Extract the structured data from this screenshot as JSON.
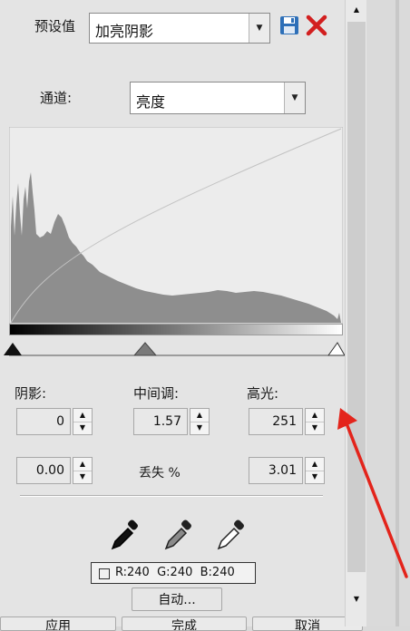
{
  "preset": {
    "label": "预设值",
    "value": "加亮阴影"
  },
  "channel": {
    "label": "通道:",
    "value": "亮度"
  },
  "levels": {
    "shadow": {
      "label": "阴影:",
      "value": "0",
      "clip": "0.00"
    },
    "midtone": {
      "label": "中间调:",
      "value": "1.57"
    },
    "highlight": {
      "label": "高光:",
      "value": "251",
      "clip": "3.01"
    },
    "clip_label": "丢失 %"
  },
  "color_readout": "R:240  G:240  B:240",
  "buttons": {
    "auto": "自动...",
    "apply": "应用",
    "ok": "完成",
    "cancel": "取消"
  },
  "icons": {
    "save": "save-icon",
    "delete": "close-icon",
    "black_eyedropper": "eyedropper-black-icon",
    "gray_eyedropper": "eyedropper-gray-icon",
    "white_eyedropper": "eyedropper-white-icon"
  },
  "colors": {
    "delete_red": "#d21f1f",
    "save_blue": "#2d6fb8",
    "annotation_red": "#e3241b"
  }
}
